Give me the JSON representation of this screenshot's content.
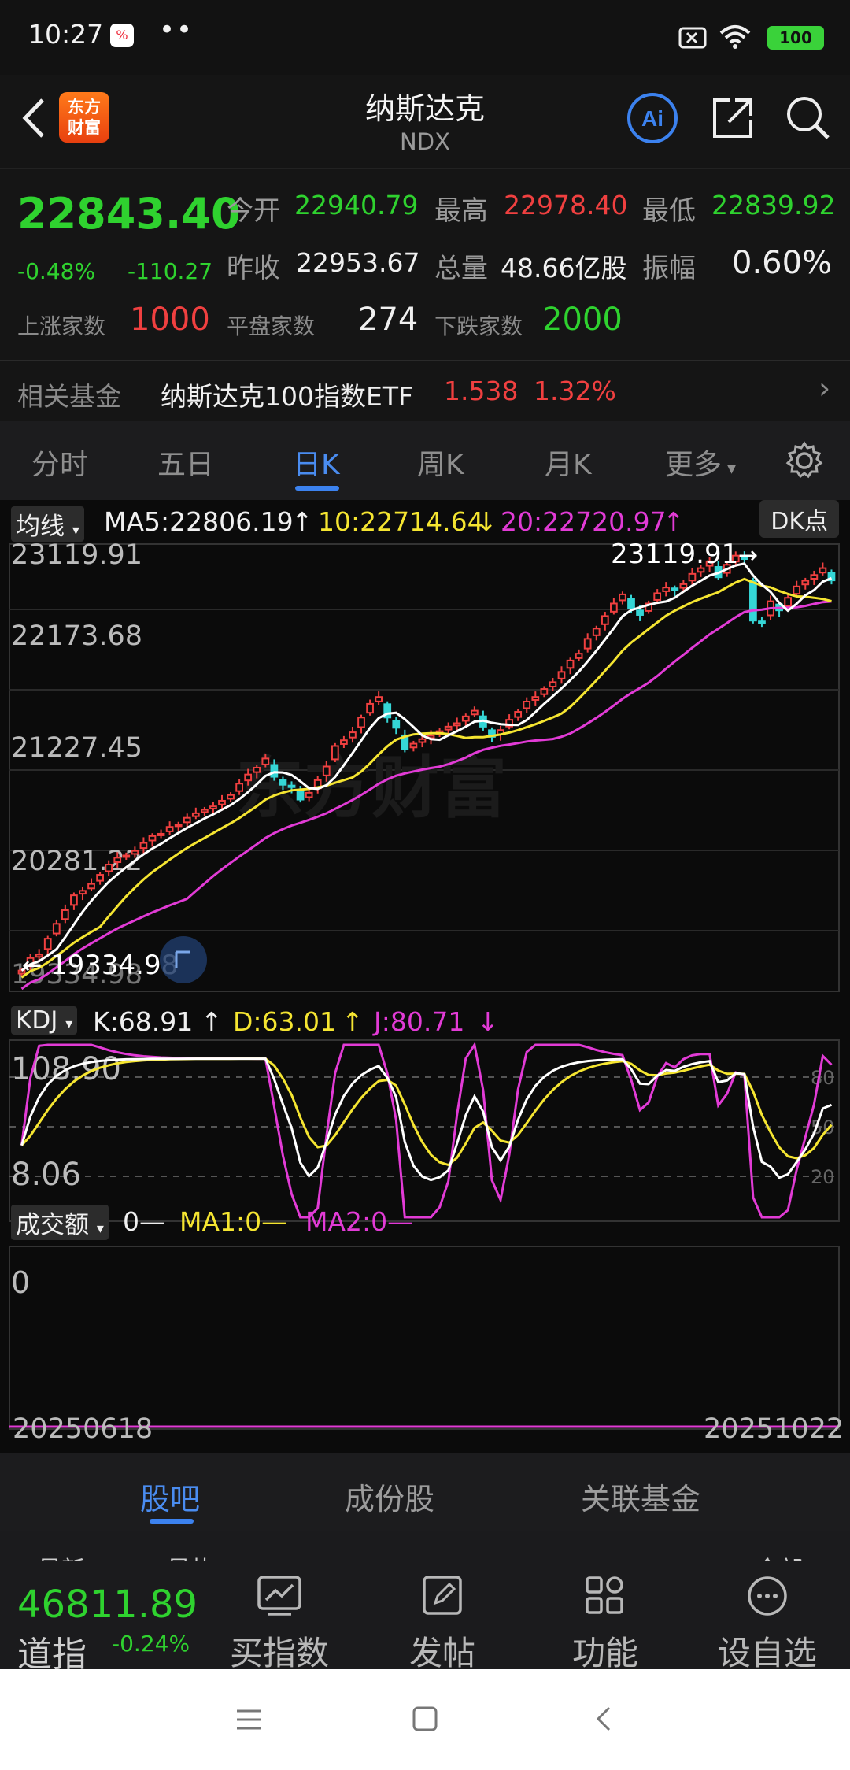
{
  "status_bar": {
    "time": "10:27",
    "dots": "••",
    "battery": "100",
    "icons": [
      "app-notification-icon",
      "sim-icon",
      "wifi-icon",
      "battery-icon"
    ]
  },
  "header": {
    "logo_line1": "东方",
    "logo_line2": "财富",
    "title": "纳斯达克",
    "subtitle": "NDX",
    "ai_label": "Ai"
  },
  "quote": {
    "price": "22843.40",
    "change_pct": "-0.48%",
    "change_abs": "-110.27",
    "open_label": "今开",
    "open": "22940.79",
    "high_label": "最高",
    "high": "22978.40",
    "low_label": "最低",
    "low": "22839.92",
    "prev_label": "昨收",
    "prev": "22953.67",
    "vol_label": "总量",
    "vol": "48.66亿股",
    "amp_label": "振幅",
    "amp": "0.60%",
    "up_label": "上涨家数",
    "up": "1000",
    "flat_label": "平盘家数",
    "flat": "274",
    "down_label": "下跌家数",
    "down": "2000"
  },
  "fund": {
    "label": "相关基金",
    "name": "纳斯达克100指数ETF",
    "price": "1.538",
    "pct": "1.32%",
    "arrow": "›"
  },
  "tabs": [
    {
      "label": "分时"
    },
    {
      "label": "五日"
    },
    {
      "label": "日K"
    },
    {
      "label": "周K"
    },
    {
      "label": "月K"
    },
    {
      "label": "更多"
    }
  ],
  "ma_header": {
    "pill": "均线",
    "ma5": "MA5:22806.19",
    "ma10": "10:22714.64",
    "ma20": "20:22720.97",
    "dk": "DK点"
  },
  "price_axis": [
    "23119.91",
    "22173.68",
    "21227.45",
    "20281.22",
    "19334.98"
  ],
  "annotations": {
    "high_marker": "23119.91",
    "low_marker": "19334.98",
    "watermark": "东方财富"
  },
  "kdj_header": {
    "pill": "KDJ",
    "k": "K:68.91",
    "d": "D:63.01",
    "j": "J:80.71",
    "top": "108.90",
    "bottom": "8.06",
    "lines": [
      "80",
      "50",
      "20"
    ]
  },
  "volume_header": {
    "pill": "成交额",
    "val": "0—",
    "ma1": "MA1:0—",
    "ma2": "MA2:0—",
    "zero": "0"
  },
  "dates": {
    "start": "20250618",
    "end": "20251022"
  },
  "subtabs": [
    {
      "label": "股吧"
    },
    {
      "label": "成份股"
    },
    {
      "label": "关联基金"
    }
  ],
  "peek_row": {
    "left": "最新",
    "mid": "最热",
    "right": "全部"
  },
  "toolbar": {
    "price": "46811.89",
    "name": "道指",
    "change": "-0.24%",
    "items": [
      {
        "label": "买指数"
      },
      {
        "label": "发帖"
      },
      {
        "label": "功能"
      },
      {
        "label": "设自选"
      }
    ]
  },
  "colors": {
    "up": "#f04040",
    "down": "#2fd22f",
    "accent": "#3c82ef",
    "ma5": "#ffffff",
    "ma10": "#f5e531",
    "ma20": "#e23bd6",
    "candle_down": "#35d6d6"
  },
  "chart_data": {
    "type": "candlestick",
    "x_start": "20250618",
    "x_end": "20251022",
    "ylim": [
      19334.98,
      23119.91
    ],
    "closes": [
      19420,
      19530,
      19560,
      19700,
      19830,
      19950,
      20080,
      20120,
      20180,
      20260,
      20350,
      20410,
      20430,
      20470,
      20540,
      20600,
      20620,
      20680,
      20700,
      20760,
      20800,
      20830,
      20860,
      20910,
      20960,
      21060,
      21140,
      21200,
      21280,
      21120,
      21050,
      21030,
      20920,
      20980,
      21090,
      21210,
      21390,
      21440,
      21510,
      21640,
      21760,
      21820,
      21640,
      21550,
      21360,
      21410,
      21450,
      21480,
      21520,
      21560,
      21590,
      21650,
      21700,
      21560,
      21470,
      21530,
      21620,
      21690,
      21780,
      21820,
      21890,
      21950,
      22040,
      22140,
      22200,
      22330,
      22420,
      22530,
      22640,
      22720,
      22600,
      22540,
      22640,
      22730,
      22780,
      22760,
      22810,
      22900,
      22950,
      23010,
      22870,
      22980,
      23060,
      23030,
      22490,
      22470,
      22660,
      22580,
      22690,
      22790,
      22840,
      22890,
      22950,
      22843
    ]
  }
}
